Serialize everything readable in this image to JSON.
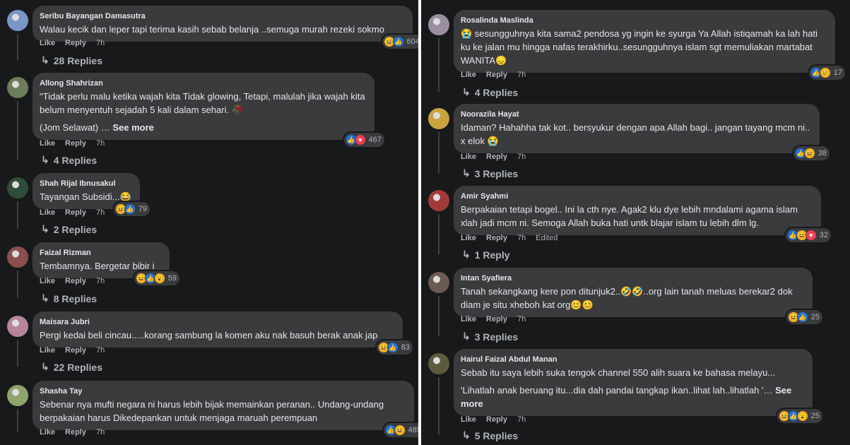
{
  "left_comments": [
    {
      "author": "Seribu Bayangan Damasutra",
      "lines": [
        "Walau kecik dan leper tapi terima kasih sebab belanja ..semuga murah rezeki sokmo"
      ],
      "see_more": "",
      "reactions": [
        "haha",
        "like"
      ],
      "count": "604",
      "like": "Like",
      "reply": "Reply",
      "time": "7h",
      "edited": "",
      "replies": "28 Replies"
    },
    {
      "author": "Allong Shahrizan",
      "lines": [
        "\"Tidak perlu malu ketika wajah kita Tidak glowing, Tetapi, malulah jika wajah kita belum menyentuh sejadah 5 kali dalam sehari. 🥀",
        "(Jom Selawat) …"
      ],
      "see_more": "See more",
      "reactions": [
        "like",
        "love"
      ],
      "count": "467",
      "like": "Like",
      "reply": "Reply",
      "time": "7h",
      "edited": "",
      "replies": "4 Replies"
    },
    {
      "author": "Shah Rijal Ibnusakul",
      "lines": [
        "Tayangan Subsidi...😂"
      ],
      "see_more": "",
      "reactions": [
        "haha",
        "like"
      ],
      "count": "79",
      "like": "Like",
      "reply": "Reply",
      "time": "7h",
      "edited": "",
      "replies": "2 Replies"
    },
    {
      "author": "Faizal Rizman",
      "lines": [
        "Tembamnya. Bergetar bibir i"
      ],
      "see_more": "",
      "reactions": [
        "haha",
        "like",
        "wow"
      ],
      "count": "59",
      "like": "Like",
      "reply": "Reply",
      "time": "7h",
      "edited": "",
      "replies": "8 Replies"
    },
    {
      "author": "Maisara Jubri",
      "lines": [
        "Pergi kedai beli cincau.....korang sambung la komen aku nak basuh berak anak jap"
      ],
      "see_more": "",
      "reactions": [
        "haha",
        "like"
      ],
      "count": "83",
      "like": "Like",
      "reply": "Reply",
      "time": "7h",
      "edited": "",
      "replies": "22 Replies"
    },
    {
      "author": "Shasha Tay",
      "lines": [
        "Sebenar nya mufti negara ni harus lebih bijak memainkan peranan.. Undang-undang berpakaian harus Dikedepankan untuk menjaga maruah perempuan"
      ],
      "see_more": "",
      "reactions": [
        "like",
        "haha"
      ],
      "count": "485",
      "like": "Like",
      "reply": "Reply",
      "time": "7h",
      "edited": "",
      "replies": ""
    }
  ],
  "right_comments": [
    {
      "author": "Rosalinda Maslinda",
      "lines": [
        "😭 sesungguhnya kita sama2 pendosa yg ingin ke syurga Ya Allah istiqamah ka lah hati ku ke jalan mu hingga nafas terakhirku..sesungguhnya islam sgt memuliakan martabat WANITA😞"
      ],
      "see_more": "",
      "reactions": [
        "like",
        "sad"
      ],
      "count": "17",
      "like": "Like",
      "reply": "Reply",
      "time": "7h",
      "edited": "",
      "replies": "4 Replies"
    },
    {
      "author": "Noorazila Hayat",
      "lines": [
        "Idaman? Hahahha tak kot.. bersyukur dengan apa Allah bagi.. jangan tayang mcm ni.. x elok 😭"
      ],
      "see_more": "",
      "reactions": [
        "like",
        "haha"
      ],
      "count": "38",
      "like": "Like",
      "reply": "Reply",
      "time": "7h",
      "edited": "",
      "replies": "3 Replies"
    },
    {
      "author": "Amir Syahmi",
      "lines": [
        "Berpakaian tetapi bogel.. Ini la cth nye. Agak2 klu dye lebih mndalami agama islam xlah jadi mcm ni. Semoga Allah buka hati untk blajar islam tu lebih dlm lg."
      ],
      "see_more": "",
      "reactions": [
        "like",
        "haha",
        "love"
      ],
      "count": "32",
      "like": "Like",
      "reply": "Reply",
      "time": "7h",
      "edited": "Edited",
      "replies": "1 Reply"
    },
    {
      "author": "Intan Syafiera",
      "lines": [
        "Tanah sekangkang kere pon ditunjuk2..🤣🤣..org lain tanah meluas berekar2 dok diam je situ xheboh kat org😊😊"
      ],
      "see_more": "",
      "reactions": [
        "haha",
        "like"
      ],
      "count": "25",
      "like": "Like",
      "reply": "Reply",
      "time": "7h",
      "edited": "",
      "replies": "3 Replies"
    },
    {
      "author": "Hairul Faizal Abdul Manan",
      "lines": [
        "Sebab itu saya lebih suka tengok channel 550 alih suara ke bahasa melayu...",
        "'Lihatlah anak beruang itu...dia dah pandai tangkap ikan..lihat lah..lihatlah '…"
      ],
      "see_more": "See more",
      "reactions": [
        "haha",
        "like",
        "wow"
      ],
      "count": "25",
      "like": "Like",
      "reply": "Reply",
      "time": "7h",
      "edited": "",
      "replies": "5 Replies"
    }
  ],
  "colors": {
    "bg": "#18191a",
    "bubble": "#3a3b3c",
    "text": "#e4e6eb",
    "muted": "#b0b3b8",
    "like": "#1b74e4",
    "love": "#f33e58",
    "haha": "#f7b125"
  },
  "icons": {
    "like": "thumbs-up-icon",
    "love": "heart-icon",
    "haha": "laughing-face-icon",
    "sad": "sad-face-icon",
    "wow": "wow-face-icon",
    "reply_arrow": "reply-arrow-icon"
  }
}
